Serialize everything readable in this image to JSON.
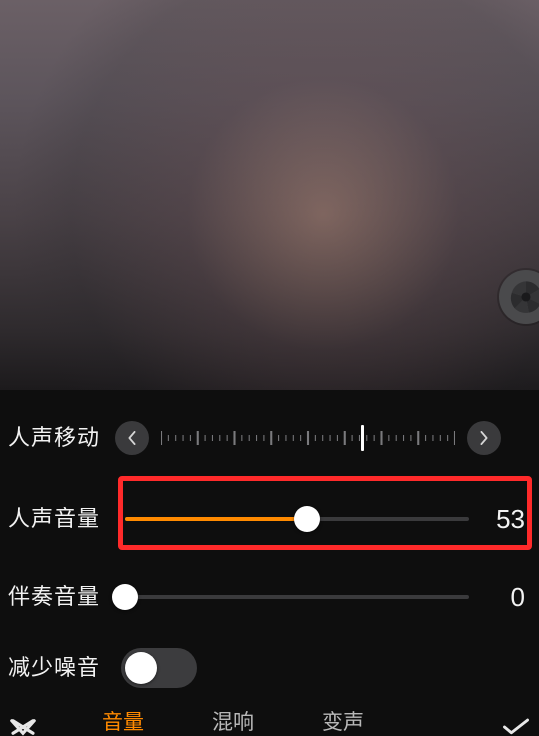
{
  "accent": "#ff8a00",
  "labels": {
    "voice_shift": "人声移动",
    "voice_volume": "人声音量",
    "accomp_volume": "伴奏音量",
    "noise_reduce": "减少噪音"
  },
  "voice_shift": {
    "position_pct": 68
  },
  "voice_volume": {
    "value": 53,
    "display": "53",
    "max": 100
  },
  "accomp_volume": {
    "value": 0,
    "display": "0",
    "max": 100
  },
  "noise_reduce": {
    "on": false
  },
  "tabs": {
    "items": [
      "音量",
      "混响",
      "变声"
    ],
    "active_index": 0
  }
}
